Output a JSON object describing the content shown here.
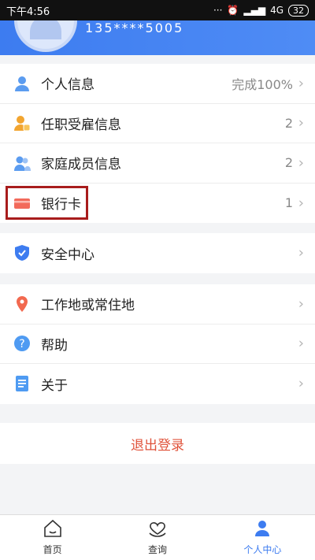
{
  "status_bar": {
    "time": "下午4:56",
    "network": "4G",
    "battery": "32"
  },
  "header": {
    "phone": "135****5005"
  },
  "menu_group1": [
    {
      "label": "个人信息",
      "value": "完成100%",
      "icon": "person-icon"
    },
    {
      "label": "任职受雇信息",
      "value": "2",
      "icon": "employment-icon"
    },
    {
      "label": "家庭成员信息",
      "value": "2",
      "icon": "family-icon"
    },
    {
      "label": "银行卡",
      "value": "1",
      "icon": "bank-card-icon"
    }
  ],
  "menu_group2": [
    {
      "label": "安全中心",
      "value": "",
      "icon": "shield-icon"
    }
  ],
  "menu_group3": [
    {
      "label": "工作地或常住地",
      "value": "",
      "icon": "location-pin-icon"
    },
    {
      "label": "帮助",
      "value": "",
      "icon": "help-icon"
    },
    {
      "label": "关于",
      "value": "",
      "icon": "document-icon"
    }
  ],
  "logout_label": "退出登录",
  "tabbar": [
    {
      "label": "首页",
      "icon": "home-icon"
    },
    {
      "label": "查询",
      "icon": "heart-hands-icon"
    },
    {
      "label": "个人中心",
      "icon": "profile-icon"
    }
  ],
  "colors": {
    "accent": "#3d7cf0",
    "logout": "#e0533b",
    "highlight_box": "#a81c1c"
  }
}
